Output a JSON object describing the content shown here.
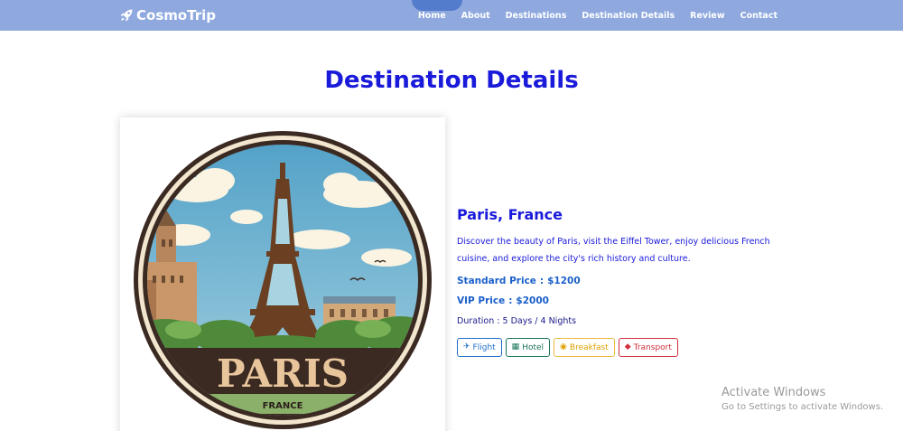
{
  "navbar": {
    "brand": "CosmoTrip",
    "links": [
      "Home",
      "About",
      "Destinations",
      "Destination Details",
      "Review",
      "Contact"
    ],
    "background_color": "#8fa9df"
  },
  "page": {
    "title": "Destination Details"
  },
  "destination": {
    "image_badge_text": "PARIS",
    "image_badge_subtext": "FRANCE",
    "name": "Paris, France",
    "description": "Discover the beauty of Paris, visit the Eiffel Tower, enjoy delicious French cuisine, and explore the city's rich history and culture.",
    "standard_price_label": "Standard Price",
    "standard_price_value": "$1200",
    "vip_price_label": "VIP Price",
    "vip_price_value": "$2000",
    "price_separator": ":",
    "duration": "Duration : 5 Days / 4 Nights",
    "amenities": [
      {
        "label": "Flight",
        "icon": "airplane-icon",
        "color": "#1f6ec9"
      },
      {
        "label": "Hotel",
        "icon": "hotel-icon",
        "color": "#18735a"
      },
      {
        "label": "Breakfast",
        "icon": "breakfast-icon",
        "color": "#e0a100"
      },
      {
        "label": "Transport",
        "icon": "car-icon",
        "color": "#d02f3c"
      }
    ]
  },
  "watermark": {
    "title": "Activate Windows",
    "subtitle": "Go to Settings to activate Windows."
  },
  "colors": {
    "heading_blue": "#1a1adb",
    "price_blue": "#1a5fc9"
  }
}
